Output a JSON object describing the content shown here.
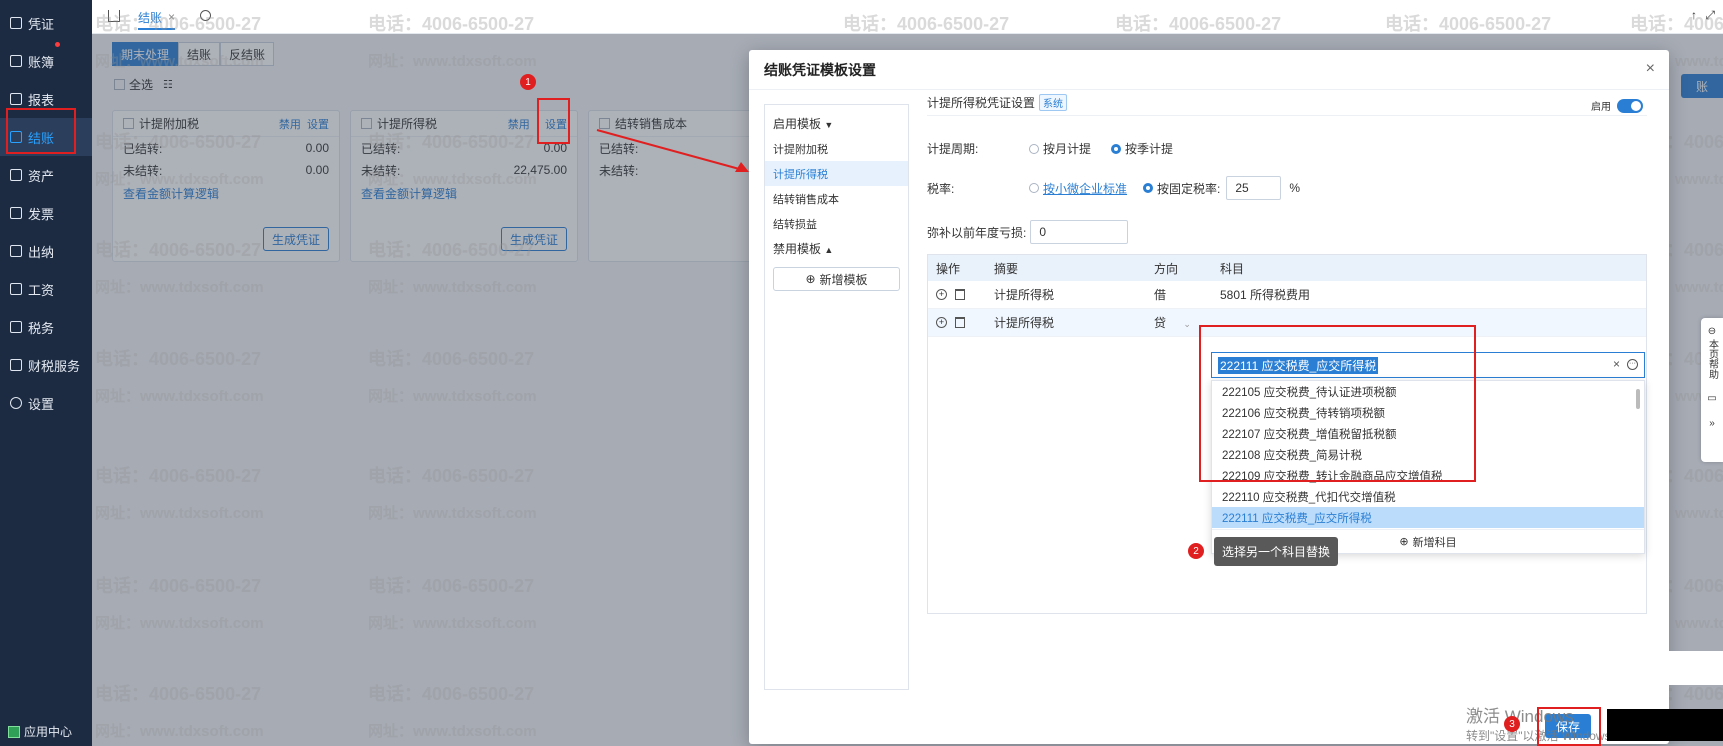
{
  "sidebar": {
    "items": [
      {
        "label": "凭证"
      },
      {
        "label": "账簿"
      },
      {
        "label": "报表"
      },
      {
        "label": "结账"
      },
      {
        "label": "资产"
      },
      {
        "label": "发票"
      },
      {
        "label": "出纳"
      },
      {
        "label": "工资"
      },
      {
        "label": "税务"
      },
      {
        "label": "财税服务"
      },
      {
        "label": "设置"
      }
    ],
    "app_center": "应用中心"
  },
  "topbar": {
    "tab_label": "结账",
    "tab_close": "×"
  },
  "main": {
    "segments": [
      "期末处理",
      "结账",
      "反结账"
    ],
    "select_all": "全选",
    "right_button": "账",
    "cards": [
      {
        "title": "计提附加税",
        "disable": "禁用",
        "settings": "设置",
        "done_label": "已结转:",
        "done_value": "0.00",
        "pending_label": "未结转:",
        "pending_value": "0.00",
        "link": "查看金额计算逻辑",
        "button": "生成凭证"
      },
      {
        "title": "计提所得税",
        "disable": "禁用",
        "settings": "设置",
        "done_label": "已结转:",
        "done_value": "0.00",
        "pending_label": "未结转:",
        "pending_value": "22,475.00",
        "link": "查看金额计算逻辑",
        "button": "生成凭证"
      },
      {
        "title": "结转销售成本",
        "done_label": "已结转:",
        "pending_label": "未结转:"
      }
    ]
  },
  "watermark": {
    "phone": "电话：4006-6500-27",
    "site": "网址：www.tdxsoft.com"
  },
  "dialog": {
    "title": "结账凭证模板设置",
    "close": "×",
    "left": {
      "enabled_header": "启用模板",
      "enabled_items": [
        "计提附加税",
        "计提所得税",
        "结转销售成本",
        "结转损益"
      ],
      "disabled_header": "禁用模板",
      "add_button": "新增模板"
    },
    "right": {
      "subtitle": "计提所得税凭证设置",
      "badge": "系统",
      "enable_label": "启用",
      "period_label": "计提周期:",
      "period_opt1": "按月计提",
      "period_opt2": "按季计提",
      "rate_label": "税率:",
      "rate_opt1": "按小微企业标准",
      "rate_opt2": "按固定税率:",
      "rate_value": "25",
      "rate_unit": "%",
      "loss_label": "弥补以前年度亏损:",
      "loss_value": "0",
      "table": {
        "headers": [
          "操作",
          "摘要",
          "方向",
          "科目"
        ],
        "rows": [
          {
            "summary": "计提所得税",
            "direction": "借",
            "account": "5801 所得税费用"
          },
          {
            "summary": "计提所得税",
            "direction": "贷",
            "account": "222111 应交税费_应交所得税"
          }
        ]
      },
      "dropdown": {
        "items": [
          "222105 应交税费_待认证进项税额",
          "222106 应交税费_待转销项税额",
          "222107 应交税费_增值税留抵税额",
          "222108 应交税费_简易计税",
          "222109 应交税费_转让金融商品应交增值税",
          "222110 应交税费_代扣代交增值税",
          "222111 应交税费_应交所得税"
        ],
        "add_label": "新增科目"
      }
    },
    "save": "保存"
  },
  "annotations": {
    "step1": "1",
    "step2": "2",
    "step3": "3",
    "tooltip": "选择另一个科目替换"
  },
  "windows_activation": {
    "line1": "激活 Windows",
    "line2": "转到\"设置\"以激活 Windows。"
  },
  "right_dock": {
    "help": "本页帮助"
  }
}
